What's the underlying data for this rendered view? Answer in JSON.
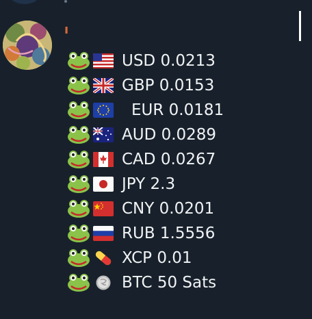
{
  "message": {
    "rows": [
      {
        "flag_icon": "us-flag-icon",
        "text": "USD 0.0213"
      },
      {
        "flag_icon": "gb-flag-icon",
        "text": "GBP 0.0153"
      },
      {
        "flag_icon": "eu-flag-icon",
        "text": "EUR 0.0181"
      },
      {
        "flag_icon": "au-flag-icon",
        "text": "AUD 0.0289"
      },
      {
        "flag_icon": "ca-flag-icon",
        "text": "CAD 0.0267"
      },
      {
        "flag_icon": "jp-flag-icon",
        "text": "JPY 2.3"
      },
      {
        "flag_icon": "cn-flag-icon",
        "text": "CNY 0.0201"
      },
      {
        "flag_icon": "ru-flag-icon",
        "text": "RUB 1.5556"
      },
      {
        "flag_icon": "pill-icon",
        "text": "XCP 0.01"
      },
      {
        "flag_icon": "coin-icon",
        "text": "BTC 50 Sats"
      }
    ]
  },
  "colors": {
    "background": "#18212b",
    "text": "#f1f3f5",
    "name_accent": "#d6673a"
  }
}
